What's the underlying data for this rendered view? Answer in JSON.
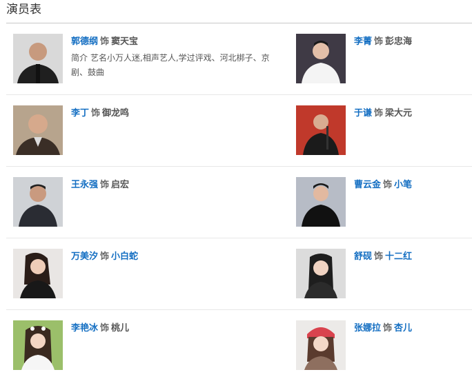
{
  "section": {
    "title": "演员表"
  },
  "as_word": "饰",
  "cast": [
    {
      "actor": "郭德纲",
      "role": "窦天宝",
      "role_link": false,
      "bio_label": "简介",
      "bio": "艺名小万人迷,相声艺人,学过评戏、河北梆子、京剧、鼓曲",
      "photo": "photo-guo-degang",
      "bg": "#d9d9d9"
    },
    {
      "actor": "李菁",
      "role": "彭忠海",
      "role_link": false,
      "photo": "photo-li-jing",
      "bg": "#3f3a45"
    },
    {
      "actor": "李丁",
      "role": "御龙鸣",
      "role_link": false,
      "photo": "photo-li-ding",
      "bg": "#b7a48d"
    },
    {
      "actor": "于谦",
      "role": "梁大元",
      "role_link": false,
      "photo": "photo-yu-qian",
      "bg": "#c0392b"
    },
    {
      "actor": "王永强",
      "role": "启宏",
      "role_link": false,
      "photo": "photo-wang-yongqiang",
      "bg": "#cfd2d6"
    },
    {
      "actor": "曹云金",
      "role": "小笔",
      "role_link": true,
      "photo": "photo-cao-yunjin",
      "bg": "#b7bcc6"
    },
    {
      "actor": "万美汐",
      "role": "小白蛇",
      "role_link": true,
      "photo": "photo-wan-meixi",
      "bg": "#e9e6e4"
    },
    {
      "actor": "舒砚",
      "role": "十二红",
      "role_link": true,
      "photo": "photo-shu-yan",
      "bg": "#dcdcdc"
    },
    {
      "actor": "李艳冰",
      "role": "桃儿",
      "role_link": false,
      "photo": "photo-li-yanbing",
      "bg": "#9bbf6a"
    },
    {
      "actor": "张娜拉",
      "role": "杏儿",
      "role_link": true,
      "photo": "photo-zhang-nala",
      "bg": "#eceae8"
    }
  ]
}
